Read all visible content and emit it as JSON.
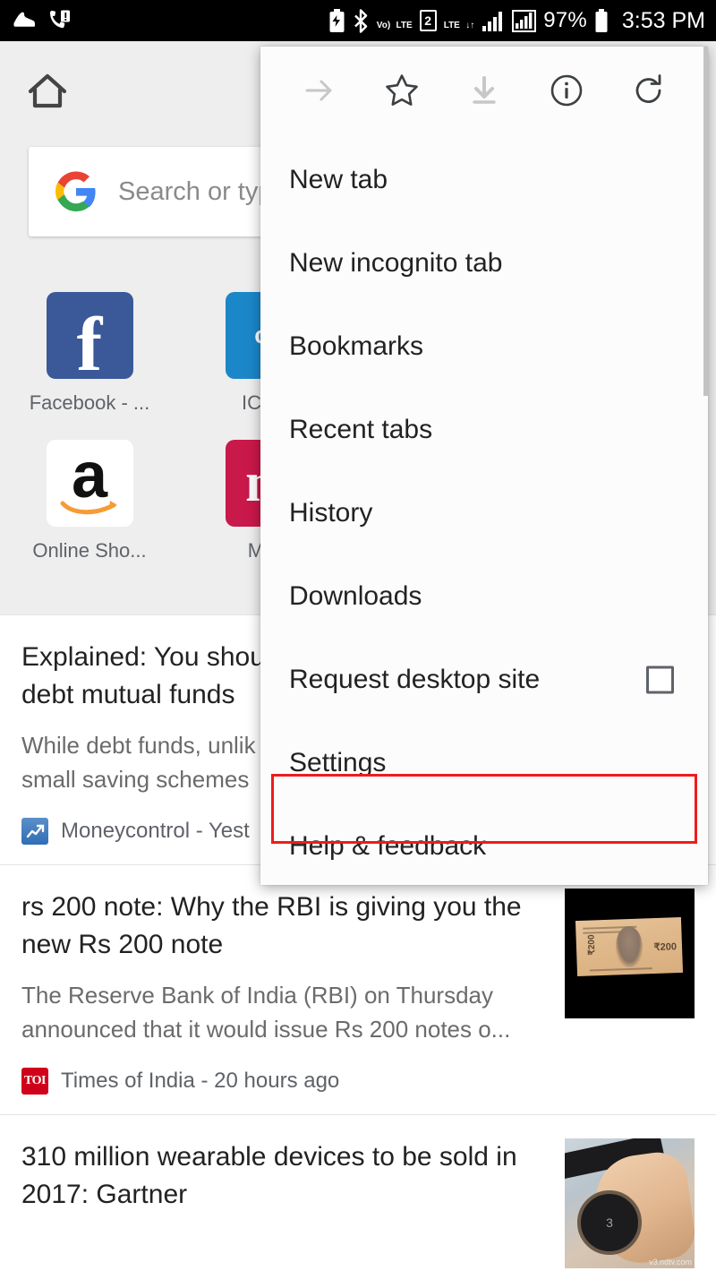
{
  "status_bar": {
    "left_icons": [
      "fitness-shoe-icon",
      "phone-alert-icon"
    ],
    "right_icons": [
      "battery-saver-icon",
      "bluetooth-icon",
      "volte-icon",
      "sim2-icon",
      "lte-data-icon",
      "signal-bars-icon",
      "signal-boxed-icon"
    ],
    "volte_top": "Vo)",
    "volte_bottom": "LTE",
    "sim_slot": "2",
    "lte_label": "LTE",
    "lte_arrows": "↓↑",
    "battery_percent": "97%",
    "clock": "3:53 PM"
  },
  "new_tab_page": {
    "home_icon": "home-icon",
    "search": {
      "placeholder": "Search or typ",
      "logo": "google-g-logo"
    },
    "tiles_row1": [
      {
        "label": "Facebook - ...",
        "glyph": "f",
        "color": "#3b5998",
        "icon_name": "facebook-tile-icon"
      },
      {
        "label": "ICC C",
        "glyph": "cri",
        "color": "#1b87c9",
        "icon_name": "cricbuzz-tile-icon"
      }
    ],
    "tiles_row2": [
      {
        "label": "Online Sho...",
        "glyph": "a",
        "color": "#ffffff",
        "icon_name": "amazon-tile-icon"
      },
      {
        "label": "Movi",
        "glyph": "m",
        "color": "#c9184a",
        "icon_name": "bookmyshow-tile-icon"
      }
    ]
  },
  "articles": [
    {
      "title_line1": "Explained: You shou",
      "title_line2": "debt mutual funds ",
      "snippet_line1": "While debt funds, unlik",
      "snippet_line2": "small saving schemes",
      "source": "Moneycontrol - Yest",
      "favicon": "moneycontrol-favicon",
      "thumbnail": null
    },
    {
      "title_line1": "rs 200 note: Why the RBI is giving you the",
      "title_line2": "new Rs 200 note",
      "snippet_line1": "The Reserve Bank of India (RBI) on Thursday",
      "snippet_line2": "announced that it would issue Rs 200 notes o...",
      "source": "Times of India - 20 hours ago",
      "favicon": "times-of-india-favicon",
      "favicon_text": "TOI",
      "thumbnail": "rupee-200-note-photo",
      "thumb_value": "₹200"
    },
    {
      "title_line1": "310 million wearable devices to be sold in",
      "title_line2": "2017: Gartner",
      "snippet_line1": "",
      "snippet_line2": "",
      "source": "",
      "favicon": "",
      "thumbnail": "smartwatch-on-wrist-photo",
      "watermark": "v3.ndtv.com"
    }
  ],
  "overflow_menu": {
    "top_icons": [
      {
        "name": "forward-arrow-icon",
        "enabled": false
      },
      {
        "name": "bookmark-star-icon",
        "enabled": true
      },
      {
        "name": "download-icon",
        "enabled": false
      },
      {
        "name": "page-info-icon",
        "enabled": true
      },
      {
        "name": "reload-icon",
        "enabled": true
      }
    ],
    "items": [
      {
        "label": "New tab",
        "type": "item"
      },
      {
        "label": "New incognito tab",
        "type": "item"
      },
      {
        "label": "Bookmarks",
        "type": "item"
      },
      {
        "label": "Recent tabs",
        "type": "item"
      },
      {
        "label": "History",
        "type": "item"
      },
      {
        "label": "Downloads",
        "type": "item"
      },
      {
        "label": "Request desktop site",
        "type": "checkbox",
        "checked": false
      },
      {
        "label": "Settings",
        "type": "item",
        "highlighted": true
      },
      {
        "label": "Help & feedback",
        "type": "item"
      }
    ],
    "highlight_color": "#ee1c1c"
  }
}
